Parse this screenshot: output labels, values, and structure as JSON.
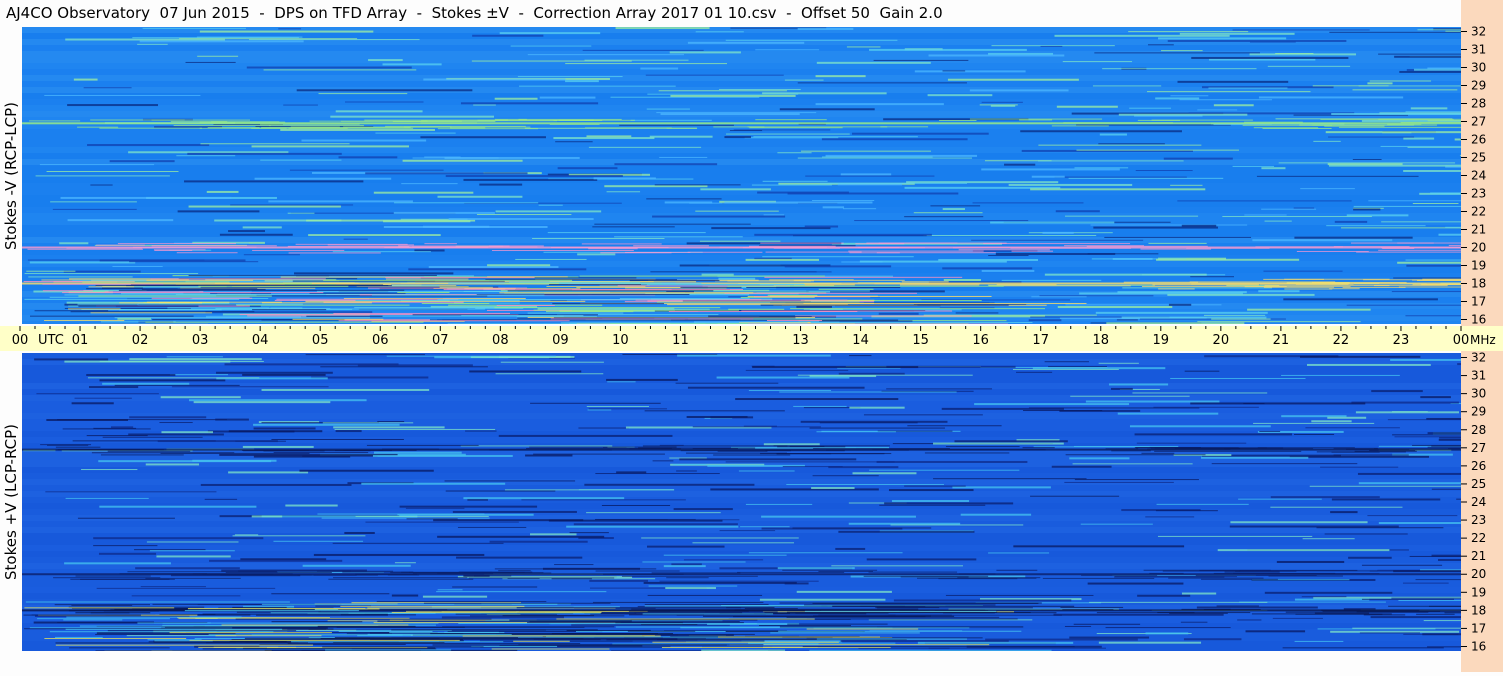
{
  "title": "AJ4CO Observatory  07 Jun 2015  -  DPS on TFD Array  -  Stokes ±V  -  Correction Array 2017 01 10.csv  -  Offset 50  Gain 2.0",
  "colors": {
    "background": "#fdfdfd",
    "time_axis_band": "#ffffc8",
    "freq_axis_band": "#fbd9bd",
    "spectrogram_top_base": "#1a82f0",
    "spectrogram_bottom_base": "#1a5fe0"
  },
  "chart_data": [
    {
      "type": "heatmap",
      "panel": "top",
      "ylabel": "Stokes -V (RCP-LCP)",
      "x_axis_label": "UTC",
      "x_tick_labels": [
        "00",
        "01",
        "02",
        "03",
        "04",
        "05",
        "06",
        "07",
        "08",
        "09",
        "10",
        "11",
        "12",
        "13",
        "14",
        "15",
        "16",
        "17",
        "18",
        "19",
        "20",
        "21",
        "22",
        "23",
        "00"
      ],
      "y_axis_unit": "MHz",
      "y_tick_labels": [
        "32",
        "31",
        "30",
        "29",
        "28",
        "27",
        "26",
        "25",
        "24",
        "23",
        "22",
        "21",
        "20",
        "19",
        "18",
        "17",
        "16"
      ],
      "ylim_mhz": [
        16,
        32
      ],
      "xlim_hours": [
        0,
        24
      ],
      "interference_bands_mhz": [
        18,
        20,
        26.9
      ]
    },
    {
      "type": "heatmap",
      "panel": "bottom",
      "ylabel": "Stokes +V (LCP-RCP)",
      "y_axis_unit": "MHz",
      "y_tick_labels": [
        "32",
        "31",
        "30",
        "29",
        "28",
        "27",
        "26",
        "25",
        "24",
        "23",
        "22",
        "21",
        "20",
        "19",
        "18",
        "17",
        "16"
      ],
      "ylim_mhz": [
        16,
        32
      ],
      "xlim_hours": [
        0,
        24
      ],
      "interference_bands_mhz": [
        18,
        20,
        26.9
      ]
    }
  ]
}
